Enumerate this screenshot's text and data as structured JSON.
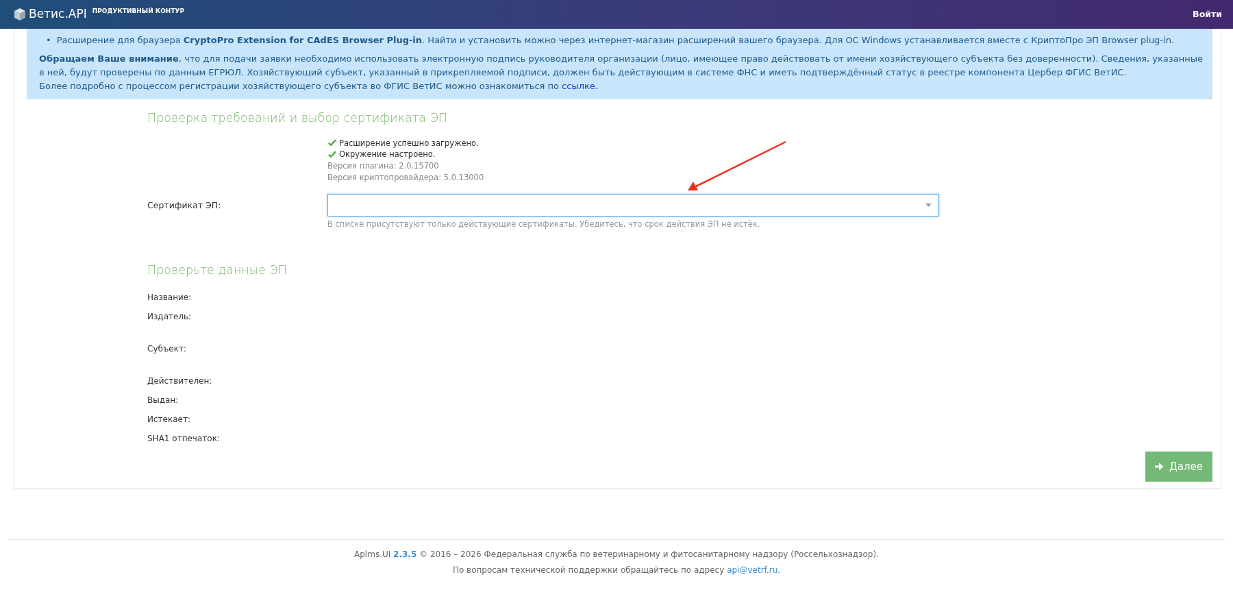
{
  "navbar": {
    "brand": "Ветис.API",
    "subtitle": "ПРОДУКТИВНЫЙ КОНТУР",
    "login": "Войти"
  },
  "notice": {
    "bullet_marker": "•",
    "bullets": [
      "Расширение для браузера **CryptoPro Extension for CAdES Browser Plug-in**. Найти и установить можно через интернет-магазин расширений вашего браузера. Для ОС Windows устанавливается вместе с КриптоПро ЭП Browser plug-in."
    ],
    "attention": "**Обращаем Ваше внимание**, что для подачи заявки необходимо использовать электронную подпись руководителя организации (лицо, имеющее право действовать от имени хозяйствующего субъекта без доверенности). Сведения, указанные в ней, будут проверены по данным ЕГРЮЛ. Хозяйствующий субъект, указанный в прикрепляемой подписи, должен быть действующим в системе ФНС и иметь подтверждённый статус в реестре компонента Цербер ФГИС ВетИС.",
    "more_info": {
      "text": "Более подробно с процессом регистрации хозяйствующего субъекта во ФГИС ВетИС можно ознакомиться по ",
      "link": "ссылке",
      "end": "."
    }
  },
  "check_section": {
    "title": "Проверка требований и выбор сертификата ЭП",
    "status_lines": [
      {
        "kind": "success",
        "text": "Расширение успешно загружено."
      },
      {
        "kind": "success",
        "text": "Окружение настроено."
      },
      {
        "kind": "info",
        "text": "Версия плагина: 2.0.15700"
      },
      {
        "kind": "info",
        "text": "Версия криптопровайдера: 5.0.13000"
      }
    ],
    "certificate": {
      "label": "Сертификат ЭП:",
      "focused": true,
      "hint": "В списке присутствуют только действующие сертификаты. Убедитесь, что срок действия ЭП не истёк."
    }
  },
  "details_section": {
    "title": "Проверьте данные ЭП",
    "fields": [
      {
        "kind": "single",
        "label": "Название:"
      },
      {
        "kind": "tall",
        "label": "Издатель:"
      },
      {
        "kind": "tall",
        "label": "Субъект:"
      },
      {
        "kind": "single",
        "label": "Действителен:"
      },
      {
        "kind": "single",
        "label": "Выдан:"
      },
      {
        "kind": "single",
        "label": "Истекает:"
      },
      {
        "kind": "single",
        "label": "SHA1 отпечаток:"
      }
    ]
  },
  "next_button": "Далее",
  "footer": {
    "app": "Aplms.UI ",
    "version": "2.3.5",
    "copyright": " © 2016 – 2026 Федеральная служба по ветеринарному и фитосанитарному надзору (Россельхознадзор).",
    "support": "По вопросам технической поддержки обращайтесь по адресу ",
    "email": "api@vetrf.ru",
    "support_end": "."
  }
}
